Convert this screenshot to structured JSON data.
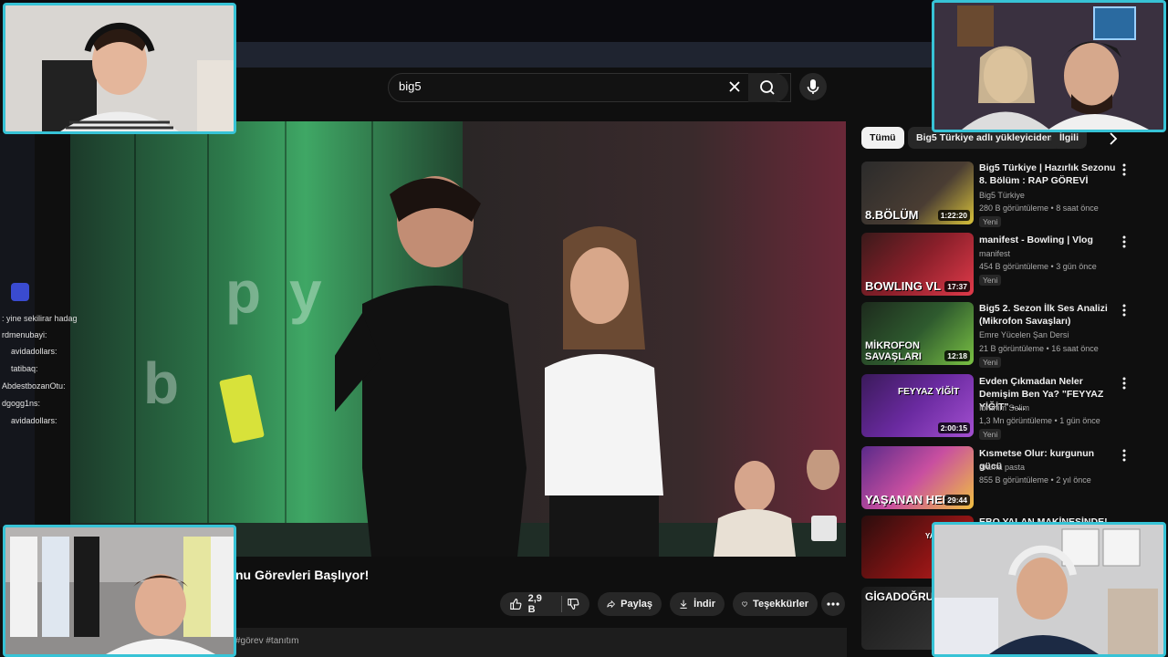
{
  "search": {
    "query": "big5"
  },
  "video": {
    "title": "nu Görevleri Başlıyor!",
    "likes": "2,9 B",
    "share_label": "Paylaş",
    "download_label": "İndir",
    "thanks_label": "Teşekkürler",
    "hashtags": "#görev #tanıtım"
  },
  "filters": [
    "Tümü",
    "Big5 Türkiye adlı yükleyiciden",
    "İlgili"
  ],
  "recommendations": [
    {
      "title": "Big5 Türkiye | Hazırlık Sezonu 8. Bölüm : RAP GÖREVİ",
      "channel": "Big5 Türkiye",
      "meta": "280 B görüntüleme • 8 saat önce",
      "badge": "Yeni",
      "duration": "1:22:20",
      "thumb_caption": "8.BÖLÜM"
    },
    {
      "title": "manifest - Bowling | Vlog",
      "channel": "manifest",
      "meta": "454 B görüntüleme • 3 gün önce",
      "badge": "Yeni",
      "duration": "17:37",
      "thumb_caption": "BOWLING VL"
    },
    {
      "title": "Big5 2. Sezon İlk Ses Analizi (Mikrofon Savaşları)",
      "channel": "Emre Yücelen Şan Dersi",
      "meta": "21 B görüntüleme • 16 saat önce",
      "badge": "Yeni",
      "duration": "12:18",
      "thumb_caption": "MİKROFON SAVAŞLARI"
    },
    {
      "title": "Evden Çıkmadan Neler Demişim Ben Ya? \"FEYYAZ YİĞİT\" - ...",
      "channel": "İbrahim Selim",
      "meta": "1,3 Mn görüntüleme • 1 gün önce",
      "badge": "Yeni",
      "duration": "2:00:15",
      "thumb_caption": "FEYYAZ YİĞİT"
    },
    {
      "title": "Kısmetse Olur: kurgunun gücü",
      "channel": "drama pasta",
      "meta": "855 B görüntüleme • 2 yıl önce",
      "badge": "",
      "duration": "29:44",
      "thumb_caption": "YAŞANAN HER"
    },
    {
      "title": "EBO YALAN MAKİNESİNDE!",
      "channel": "",
      "meta": "",
      "badge": "",
      "duration": "",
      "thumb_caption": "YALAN"
    },
    {
      "title": "",
      "channel": "",
      "meta": "",
      "badge": "",
      "duration": "",
      "thumb_caption": "GİGADOĞRU"
    }
  ],
  "chat": [
    {
      "user": "",
      "msg": ": yine sekilirar hadag"
    },
    {
      "user": "rdmenubayi",
      "msg": ":"
    },
    {
      "user": "avidadollars",
      "msg": ":"
    },
    {
      "user": "tatibaq",
      "msg": ":"
    },
    {
      "user": "AbdestbozanOtu",
      "msg": ":"
    },
    {
      "user": "dgogg1ns",
      "msg": ":"
    },
    {
      "user": "avidadollars",
      "msg": ":"
    }
  ],
  "colors": {
    "cam_border": "#37c3d6",
    "background": "#0f0f0f",
    "chip_active": "#f1f1f1"
  }
}
